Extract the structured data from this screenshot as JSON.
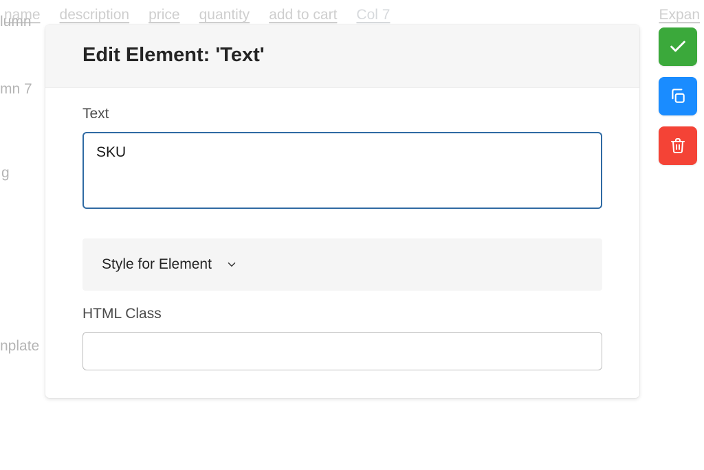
{
  "background": {
    "tabs": [
      "name",
      "description",
      "price",
      "quantity",
      "add to cart",
      "Col 7"
    ],
    "expand": "Expan",
    "lumn": "lumn",
    "umn7": "mn 7",
    "g": "g",
    "plate": "nplate"
  },
  "panel": {
    "title": "Edit Element: 'Text'",
    "text_label": "Text",
    "text_value": "SKU",
    "style_toggle": "Style for Element",
    "html_class_label": "HTML Class",
    "html_class_value": ""
  },
  "actions": {
    "confirm": "Confirm",
    "duplicate": "Duplicate",
    "delete": "Delete"
  }
}
